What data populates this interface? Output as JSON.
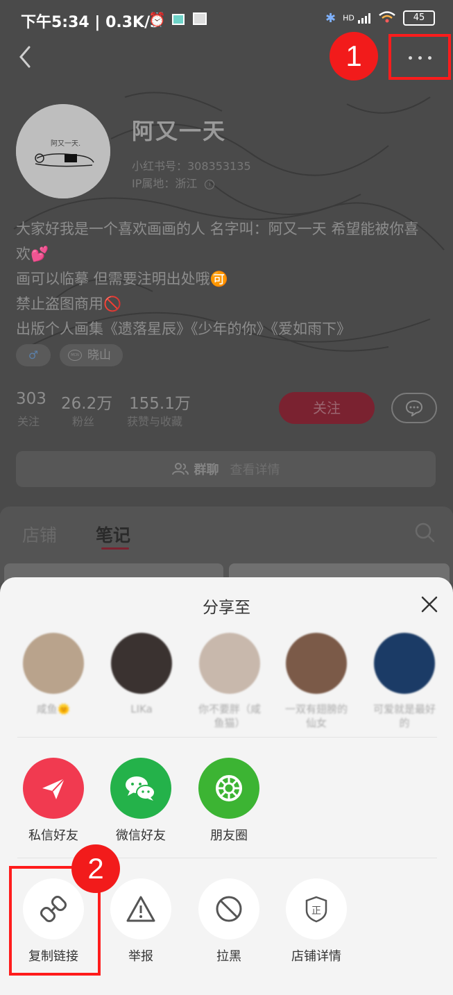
{
  "status_bar": {
    "time": "下午5:34 | 0.3K/s",
    "battery": "45",
    "network": "HD"
  },
  "callouts": {
    "first": "1",
    "second": "2"
  },
  "profile": {
    "name": "阿又一天",
    "id_line": "小红书号：308353135",
    "ip_line": "IP属地：浙江",
    "bio": [
      "大家好我是一个喜欢画画的人 名字叫：阿又一天 希望能被你喜",
      "欢💕",
      "画可以临摹 但需要注明出处哦🉑",
      "禁止盗图商用🚫",
      "出版个人画集《遗落星辰》《少年的你》《爱如雨下》"
    ],
    "tag_mcn_prefix": "MCN",
    "tag_mcn": "晓山",
    "stats": [
      {
        "num": "303",
        "label": "关注"
      },
      {
        "num": "26.2万",
        "label": "粉丝"
      },
      {
        "num": "155.1万",
        "label": "获赞与收藏"
      }
    ],
    "follow_label": "关注",
    "group_label": "群聊",
    "group_detail": "查看详情"
  },
  "tabs": [
    {
      "label": "店铺",
      "active": false
    },
    {
      "label": "笔记",
      "active": true
    }
  ],
  "share_sheet": {
    "title": "分享至",
    "contacts": [
      {
        "name": "咸鱼🌞",
        "color": "#b9a38c"
      },
      {
        "name": "LIKa",
        "color": "#3a3230"
      },
      {
        "name": "你不要胖（咸鱼猫）",
        "color": "#c8b8ac"
      },
      {
        "name": "一双有翅膀的仙女",
        "color": "#7b5a48"
      },
      {
        "name": "可爱就是最好的",
        "color": "#1b3b66"
      }
    ],
    "share_targets": [
      {
        "label": "私信好友",
        "color": "#f13a50",
        "icon": "paper-plane-icon"
      },
      {
        "label": "微信好友",
        "color": "#24b24a",
        "icon": "wechat-icon"
      },
      {
        "label": "朋友圈",
        "color": "#3cb433",
        "icon": "moments-icon"
      }
    ],
    "actions": [
      {
        "label": "复制链接",
        "icon": "link-icon"
      },
      {
        "label": "举报",
        "icon": "warning-icon"
      },
      {
        "label": "拉黑",
        "icon": "block-icon"
      },
      {
        "label": "店铺详情",
        "icon": "shop-badge-icon",
        "icon_text": "正"
      }
    ]
  },
  "colors": {
    "highlight": "#ff1c1c",
    "brand": "#ff2442",
    "overlay": "#4a4a4a"
  }
}
